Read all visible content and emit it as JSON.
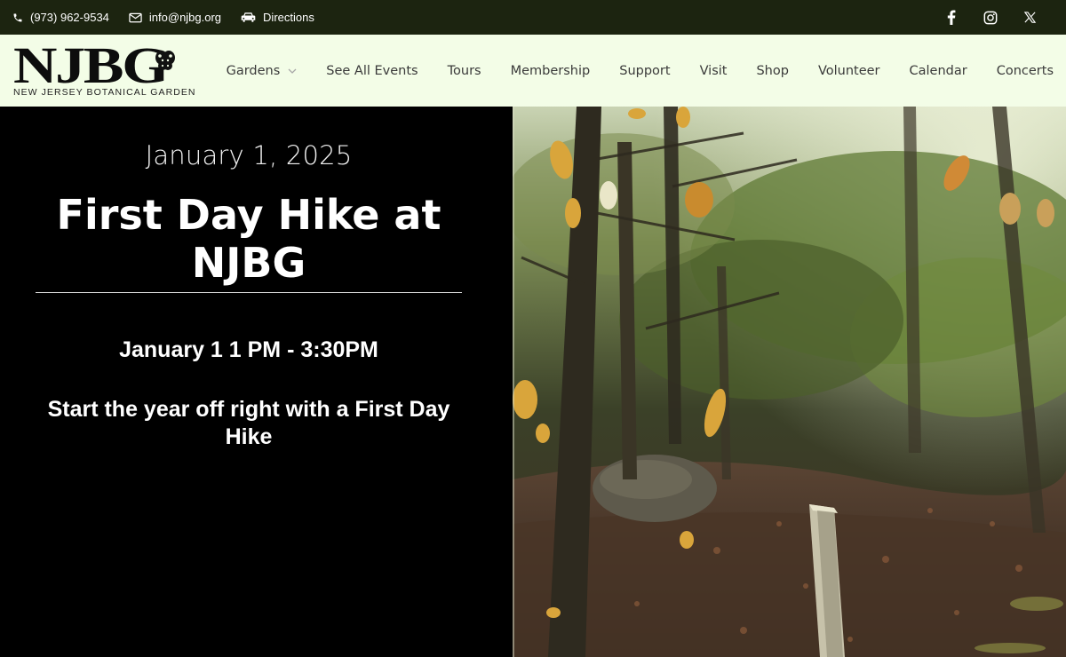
{
  "topbar": {
    "phone": "(973) 962-9534",
    "email": "info@njbg.org",
    "directions": "Directions",
    "social": [
      "facebook-icon",
      "instagram-icon",
      "x-icon"
    ]
  },
  "logo": {
    "mark": "NJBG",
    "subtitle": "NEW JERSEY BOTANICAL GARDEN"
  },
  "nav": {
    "items": [
      "Gardens",
      "See All Events",
      "Tours",
      "Membership",
      "Support",
      "Visit",
      "Shop",
      "Volunteer",
      "Calendar",
      "Concerts"
    ]
  },
  "event": {
    "date": "January 1, 2025",
    "title": "First Day Hike at NJBG",
    "time": "January 1 1 PM - 3:30PM",
    "description": "Start the year off right with a First Day Hike"
  },
  "colors": {
    "topbar_bg": "#1c2410",
    "nav_bg": "#f3fde7",
    "hero_bg": "#000000"
  }
}
